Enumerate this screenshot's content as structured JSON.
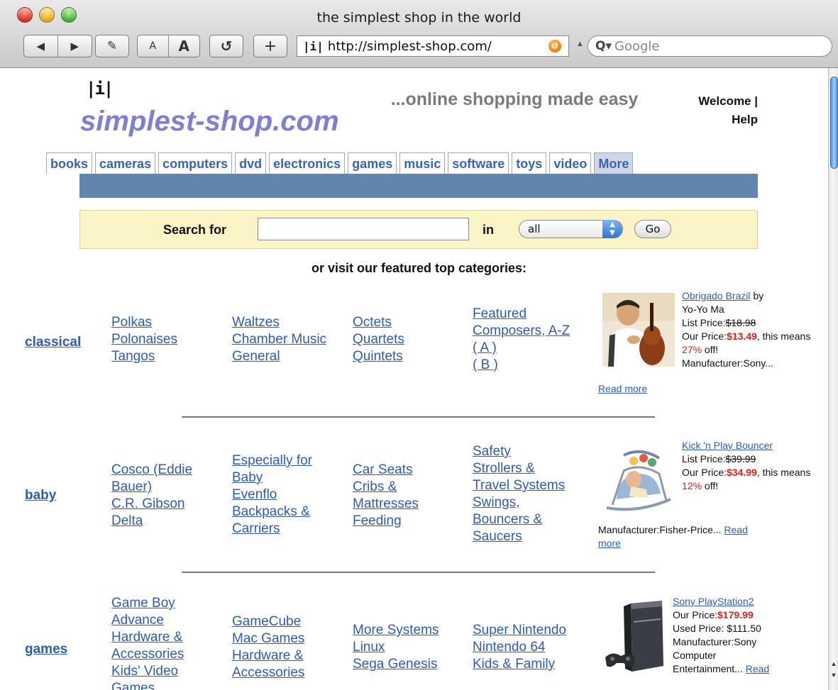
{
  "window": {
    "title": "the simplest shop in the world"
  },
  "toolbar": {
    "back_glyph": "◀",
    "forward_glyph": "▶",
    "edit_glyph": "✎",
    "font_small": "A",
    "font_large": "A",
    "reload_glyph": "↺",
    "add_glyph": "+",
    "url": "http://simplest-shop.com/",
    "site_icon": "|i|",
    "search_placeholder": "Google",
    "search_icon_glyph": "Q▾"
  },
  "header": {
    "logo_mark": "|i|",
    "logo_text": "simplest-shop.com",
    "tagline": "...online shopping made easy",
    "welcome": "Welcome |",
    "help": "Help"
  },
  "tabs": [
    {
      "label": "books"
    },
    {
      "label": "cameras"
    },
    {
      "label": "computers"
    },
    {
      "label": "dvd"
    },
    {
      "label": "electronics"
    },
    {
      "label": "games"
    },
    {
      "label": "music"
    },
    {
      "label": "software"
    },
    {
      "label": "toys"
    },
    {
      "label": "video"
    },
    {
      "label": "More"
    }
  ],
  "search": {
    "label": "Search for",
    "in_label": "in",
    "category": "all",
    "go": "Go"
  },
  "featured_heading": "or visit our featured top categories:",
  "categories": {
    "classical": {
      "name": "classical",
      "col1": [
        "Polkas",
        "Polonaises",
        "Tangos"
      ],
      "col2": [
        "Waltzes",
        "Chamber Music",
        "General"
      ],
      "col3": [
        "Octets",
        "Quartets",
        "Quintets"
      ],
      "col4": [
        "Featured",
        "Composers, A-Z",
        "( A )",
        "( B )"
      ],
      "product": {
        "title": "Obrigado Brazil",
        "by": " by",
        "artist": "Yo-Yo Ma",
        "list_label": "List Price:",
        "list_price": "$18.98",
        "our_label": "Our Price:",
        "our_price": "$13.49",
        "means": ", this means ",
        "percent": "27%",
        "off": " off!",
        "manufacturer": "Manufacturer:Sony...",
        "read_more": "Read more"
      }
    },
    "baby": {
      "name": "baby",
      "col1": [
        "Cosco (Eddie",
        "Bauer)",
        "C.R. Gibson",
        "Delta"
      ],
      "col2": [
        "Especially for",
        "Baby",
        "Evenflo",
        "Backpacks &",
        "Carriers"
      ],
      "col3": [
        "Car Seats",
        "Cribs &",
        "Mattresses",
        "Feeding"
      ],
      "col4": [
        "Safety",
        "Strollers &",
        "Travel Systems",
        "Swings,",
        "Bouncers &",
        "Saucers"
      ],
      "product": {
        "title": "Kick 'n Play Bouncer",
        "list_label": "List Price:",
        "list_price": "$39.99",
        "our_label": "Our Price:",
        "our_price": "$34.99",
        "means": ", this means ",
        "percent": "12%",
        "off": " off!",
        "manufacturer": "Manufacturer:Fisher-Price... ",
        "read_more_1": "Read",
        "read_more_2": "more"
      }
    },
    "games": {
      "name": "games",
      "col1": [
        "Game Boy",
        "Advance",
        "Hardware &",
        "Accessories",
        "Kids' Video",
        "Games"
      ],
      "col2": [
        "GameCube",
        "Mac Games",
        "Hardware &",
        "Accessories"
      ],
      "col3": [
        "More Systems",
        "Linux",
        "Sega Genesis"
      ],
      "col4": [
        "Super Nintendo",
        "Nintendo 64",
        "Kids & Family"
      ],
      "product": {
        "title": "Sony PlayStation2",
        "our_label": "Our Price:",
        "our_price": "$179.99",
        "used": "Used Price: $111.50",
        "manufacturer_1": "Manufacturer:Sony",
        "manufacturer_2": "Computer",
        "manufacturer_3": "Entertainment... ",
        "read_more": "Read"
      }
    }
  },
  "colors": {
    "link": "#2e5bb8",
    "logo": "#7b7fd9",
    "nav_bar": "#6285ad",
    "search_bg": "#fbf4c7",
    "price_red": "#e0201b"
  }
}
